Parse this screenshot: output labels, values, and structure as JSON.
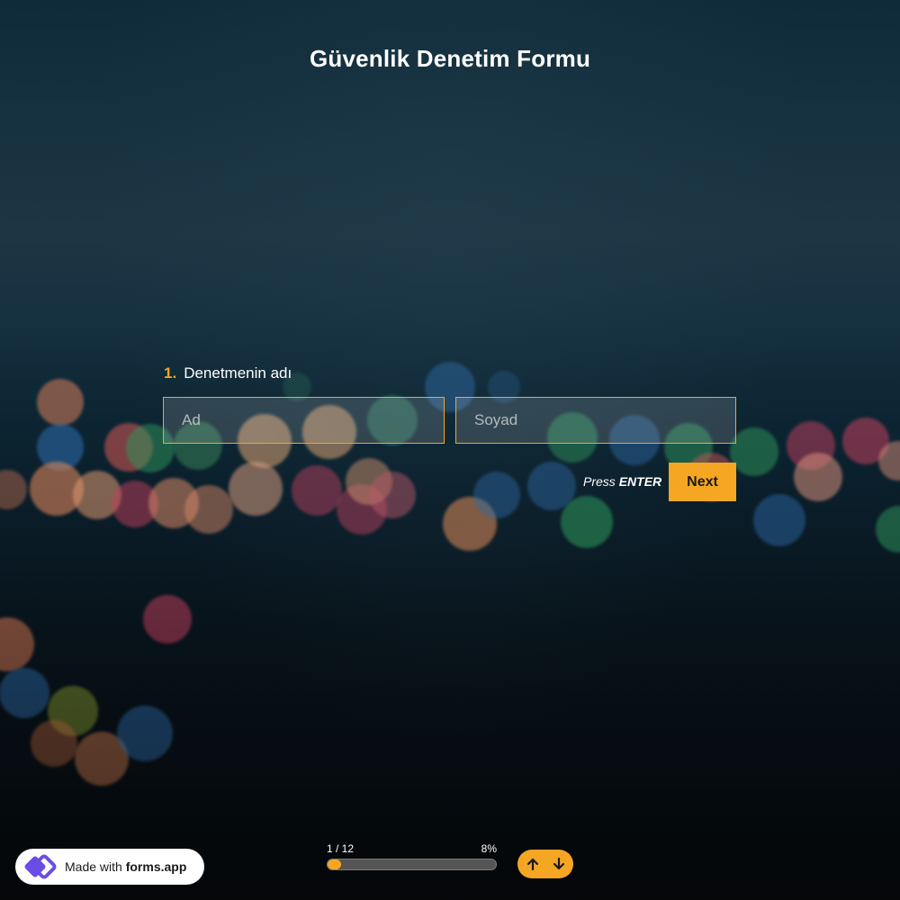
{
  "form": {
    "title": "Güvenlik Denetim Formu"
  },
  "question": {
    "number": "1.",
    "label": "Denetmenin adı",
    "first_name_placeholder": "Ad",
    "last_name_placeholder": "Soyad",
    "first_name_value": "",
    "last_name_value": ""
  },
  "actions": {
    "press_prefix": "Press",
    "press_key": "ENTER",
    "next_label": "Next"
  },
  "progress": {
    "step_text": "1 / 12",
    "percent_text": "8%",
    "current": 1,
    "total": 12,
    "percent": 8
  },
  "badge": {
    "prefix": "Made with",
    "brand": "forms.app"
  },
  "icons": {
    "logo": "forms-app-logo-icon",
    "up": "arrow-up-icon",
    "down": "arrow-down-icon"
  },
  "colors": {
    "accent": "#f5a623",
    "text": "#ffffff",
    "logo": "#6b4ce6"
  }
}
